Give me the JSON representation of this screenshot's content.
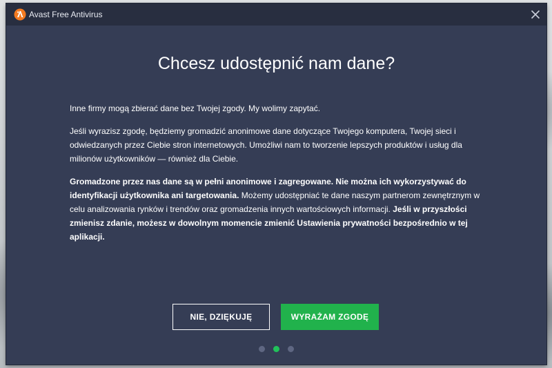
{
  "window": {
    "title": "Avast Free Antivirus",
    "logo_icon": "avast-logo-icon",
    "close_icon": "close-icon"
  },
  "dialog": {
    "title": "Chcesz udostępnić nam dane?",
    "para1": "Inne firmy mogą zbierać dane bez Twojej zgody. My wolimy zapytać.",
    "para2": "Jeśli wyrazisz zgodę, będziemy gromadzić anonimowe dane dotyczące Twojego komputera, Twojej sieci i odwiedzanych przez Ciebie stron internetowych. Umożliwi nam to tworzenie lepszych produktów i usług dla milionów użytkowników — również dla Ciebie.",
    "para3_bold1": "Gromadzone przez nas dane są w pełni anonimowe i zagregowane. Nie można ich wykorzystywać do identyfikacji użytkownika ani targetowania.",
    "para3_normal": " Możemy udostępniać te dane naszym partnerom zewnętrznym w celu analizowania rynków i trendów oraz gromadzenia innych wartościowych informacji. ",
    "para3_bold2": "Jeśli w przyszłości zmienisz zdanie, możesz w dowolnym momencie zmienić Ustawienia prywatności bezpośrednio w tej aplikacji."
  },
  "buttons": {
    "decline": "NIE, DZIĘKUJĘ",
    "accept": "WYRAŻAM ZGODĘ"
  },
  "pagination": {
    "total": 3,
    "current": 2
  },
  "colors": {
    "window_bg": "#353d55",
    "titlebar_bg": "#282e40",
    "accept_green": "#21b24c",
    "logo_orange": "#f47a20",
    "dot_active": "#21c25a"
  }
}
